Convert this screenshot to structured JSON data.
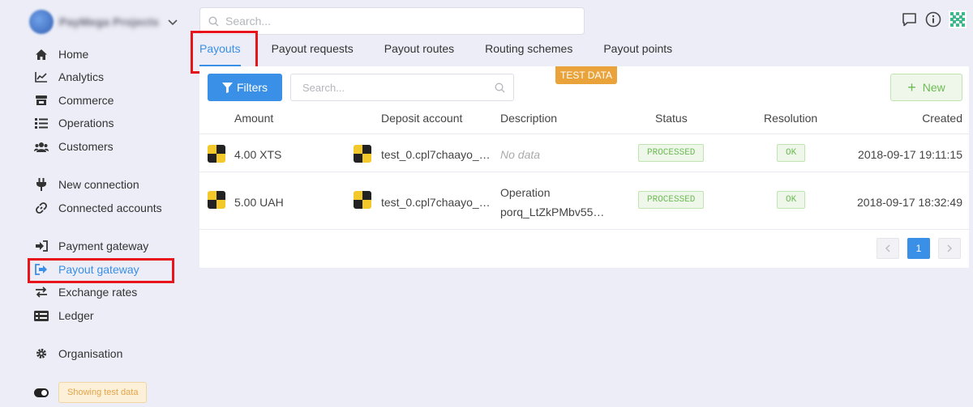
{
  "sidebar": {
    "project_name": "PayMega Projects",
    "groups": [
      [
        {
          "label": "Home",
          "icon": "home-icon"
        },
        {
          "label": "Analytics",
          "icon": "analytics-icon"
        },
        {
          "label": "Commerce",
          "icon": "store-icon"
        },
        {
          "label": "Operations",
          "icon": "list-icon"
        },
        {
          "label": "Customers",
          "icon": "users-icon"
        }
      ],
      [
        {
          "label": "New connection",
          "icon": "plug-icon"
        },
        {
          "label": "Connected accounts",
          "icon": "link-icon"
        }
      ],
      [
        {
          "label": "Payment gateway",
          "icon": "sign-in-icon"
        },
        {
          "label": "Payout gateway",
          "icon": "sign-out-icon",
          "active": true
        },
        {
          "label": "Exchange rates",
          "icon": "exchange-icon"
        },
        {
          "label": "Ledger",
          "icon": "ledger-icon"
        }
      ],
      [
        {
          "label": "Organisation",
          "icon": "gear-icon"
        }
      ]
    ],
    "test_toggle_label": "Showing test data"
  },
  "top": {
    "search_placeholder": "Search..."
  },
  "tabs": [
    "Payouts",
    "Payout requests",
    "Payout routes",
    "Routing schemes",
    "Payout points"
  ],
  "active_tab": "Payouts",
  "toolbar": {
    "filters_label": "Filters",
    "search_placeholder": "Search...",
    "test_data_label": "TEST DATA",
    "new_label": "New"
  },
  "table": {
    "columns": [
      "Amount",
      "Deposit account",
      "Description",
      "Status",
      "Resolution",
      "Created"
    ],
    "rows": [
      {
        "amount": "4.00 XTS",
        "account": "test_0.cpl7chaayo_…",
        "description_1": "No data",
        "description_2": "",
        "status": "PROCESSED",
        "resolution": "OK",
        "created": "2018-09-17 19:11:15"
      },
      {
        "amount": "5.00 UAH",
        "account": "test_0.cpl7chaayo_…",
        "description_1": "Operation",
        "description_2": "porq_LtZkPMbv55…",
        "status": "PROCESSED",
        "resolution": "OK",
        "created": "2018-09-17 18:32:49"
      }
    ]
  },
  "pagination": {
    "current": "1"
  },
  "colors": {
    "accent": "#3a8fe6",
    "highlight": "#e8141c",
    "success": "#6dbb55",
    "test": "#e9a33a"
  }
}
